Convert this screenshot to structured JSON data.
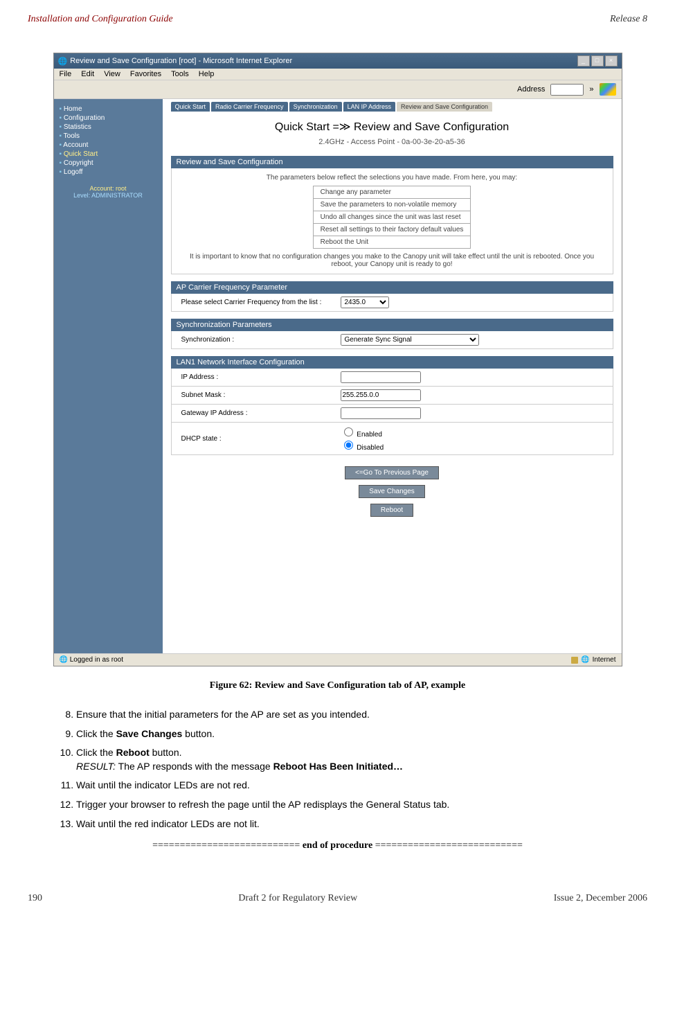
{
  "header": {
    "left": "Installation and Configuration Guide",
    "right": "Release 8"
  },
  "browser": {
    "title": "Review and Save Configuration [root] - Microsoft Internet Explorer",
    "menu": [
      "File",
      "Edit",
      "View",
      "Favorites",
      "Tools",
      "Help"
    ],
    "address_label": "Address"
  },
  "sidebar": {
    "items": [
      {
        "label": "Home",
        "highlight": false
      },
      {
        "label": "Configuration",
        "highlight": false
      },
      {
        "label": "Statistics",
        "highlight": false
      },
      {
        "label": "Tools",
        "highlight": false
      },
      {
        "label": "Account",
        "highlight": false
      },
      {
        "label": "Quick Start",
        "highlight": true
      },
      {
        "label": "Copyright",
        "highlight": false
      },
      {
        "label": "Logoff",
        "highlight": false
      }
    ],
    "account": "Account: root",
    "level": "Level: ADMINISTRATOR"
  },
  "tabs": [
    "Quick Start",
    "Radio Carrier Frequency",
    "Synchronization",
    "LAN IP Address",
    "Review and Save Configuration"
  ],
  "main": {
    "title": "Quick Start =≫ Review and Save Configuration",
    "subtitle": "2.4GHz - Access Point - 0a-00-3e-20-a5-36"
  },
  "sections": {
    "review": {
      "header": "Review and Save Configuration",
      "intro": "The parameters below reflect the selections you have made. From here, you may:",
      "options": [
        "Change any parameter",
        "Save the parameters to non-volatile memory",
        "Undo all changes since the unit was last reset",
        "Reset all settings to their factory default values",
        "Reboot the Unit"
      ],
      "note": "It is important to know that no configuration changes you make to the Canopy unit will take effect until the unit is rebooted. Once you reboot, your Canopy unit is ready to go!"
    },
    "freq": {
      "header": "AP Carrier Frequency Parameter",
      "label": "Please select Carrier Frequency from the list :",
      "value": "2435.0"
    },
    "sync": {
      "header": "Synchronization Parameters",
      "label": "Synchronization :",
      "value": "Generate Sync Signal"
    },
    "lan": {
      "header": "LAN1 Network Interface Configuration",
      "ip_label": "IP Address :",
      "ip_value": "",
      "subnet_label": "Subnet Mask :",
      "subnet_value": "255.255.0.0",
      "gateway_label": "Gateway IP Address :",
      "gateway_value": "",
      "dhcp_label": "DHCP state :",
      "dhcp_enabled": "Enabled",
      "dhcp_disabled": "Disabled"
    }
  },
  "buttons": {
    "prev": "<=Go To Previous Page",
    "save": "Save Changes",
    "reboot": "Reboot"
  },
  "statusbar": {
    "left": "Logged in as root",
    "right": "Internet"
  },
  "caption": "Figure 62: Review and Save Configuration tab of AP, example",
  "procedure": {
    "item8": "Ensure that the initial parameters for the AP are set as you intended.",
    "item9a": "Click the ",
    "item9b": "Save Changes",
    "item9c": " button.",
    "item10a": "Click the ",
    "item10b": "Reboot",
    "item10c": " button.",
    "item10d": "RESULT:",
    "item10e": " The AP responds with the message ",
    "item10f": "Reboot Has Been Initiated…",
    "item11": "Wait until the indicator LEDs are not red.",
    "item12": "Trigger your browser to refresh the page until the AP redisplays the General Status tab.",
    "item13": "Wait until the red indicator LEDs are not lit."
  },
  "end_procedure": "=========================== end of procedure ===========================",
  "footer": {
    "left": "190",
    "center": "Draft 2 for Regulatory Review",
    "right": "Issue 2, December 2006"
  }
}
